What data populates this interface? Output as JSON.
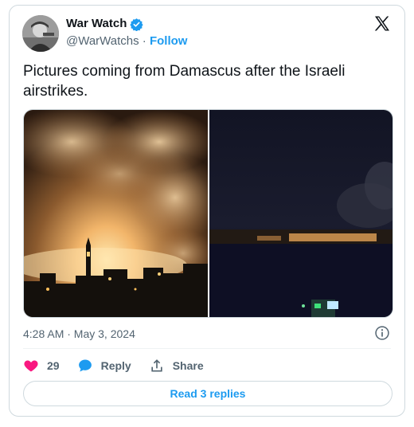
{
  "author": {
    "name": "War Watch",
    "handle": "@WarWatchs",
    "separator": "·",
    "follow_label": "Follow"
  },
  "tweet": {
    "text": "Pictures coming from Damascus after the Israeli airstrikes.",
    "timestamp": "4:28 AM · May 3, 2024"
  },
  "actions": {
    "like_count": "29",
    "reply_label": "Reply",
    "share_label": "Share",
    "read_replies_label": "Read 3 replies"
  },
  "icons": {
    "verified": "verified-badge-icon",
    "logo": "x-logo-icon",
    "info": "info-icon",
    "like": "heart-icon",
    "reply": "reply-bubble-icon",
    "share": "share-icon"
  },
  "colors": {
    "accent": "#1d9bf0",
    "like": "#f91880",
    "text": "#0f1419",
    "muted": "#536471",
    "border": "#cfd9de"
  }
}
